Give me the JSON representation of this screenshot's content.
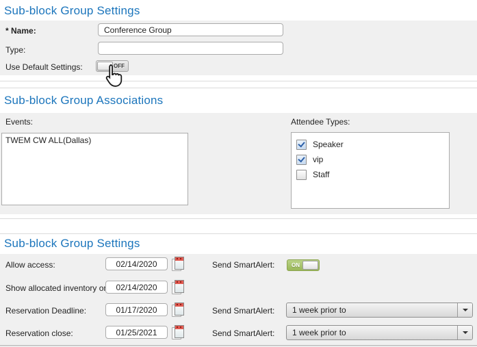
{
  "colors": {
    "header_blue": "#1B75BC",
    "panel_bg": "#F0F0F0",
    "toggle_on_green": "#9AB858",
    "input_border": "#ABABAB",
    "calendar_red": "#E25B52",
    "checkbox_check_blue": "#2B5FA8"
  },
  "settings_top": {
    "title": "Sub-block Group Settings",
    "name_label": "* Name:",
    "name_value": "Conference Group",
    "type_label": "Type:",
    "type_value": "",
    "use_default_label": "Use Default Settings:",
    "use_default_toggle": {
      "state": "OFF",
      "text": "OFF"
    }
  },
  "associations": {
    "title": "Sub-block Group Associations",
    "events_label": "Events:",
    "events_items": [
      "TWEM CW ALL(Dallas)"
    ],
    "attendee_label": "Attendee Types:",
    "attendee_options": [
      {
        "label": "Speaker",
        "checked": true
      },
      {
        "label": "vip",
        "checked": true
      },
      {
        "label": "Staff",
        "checked": false
      }
    ]
  },
  "settings_bottom": {
    "title": "Sub-block Group Settings",
    "rows": [
      {
        "label": "Allow access:",
        "date": "02/14/2020",
        "alert_label": "Send SmartAlert:",
        "toggle": {
          "state": "ON",
          "text": "ON"
        }
      },
      {
        "label": "Show allocated inventory on:",
        "date": "02/14/2020"
      },
      {
        "label": "Reservation Deadline:",
        "date": "01/17/2020",
        "alert_label": "Send SmartAlert:",
        "select_value": "1 week prior to"
      },
      {
        "label": "Reservation close:",
        "date": "01/25/2021",
        "alert_label": "Send SmartAlert:",
        "select_value": "1 week prior to"
      }
    ]
  },
  "icons": {
    "calendar": "calendar-icon",
    "dropdown_arrow": "chevron-down-icon",
    "cursor": "hand-pointer-cursor"
  }
}
